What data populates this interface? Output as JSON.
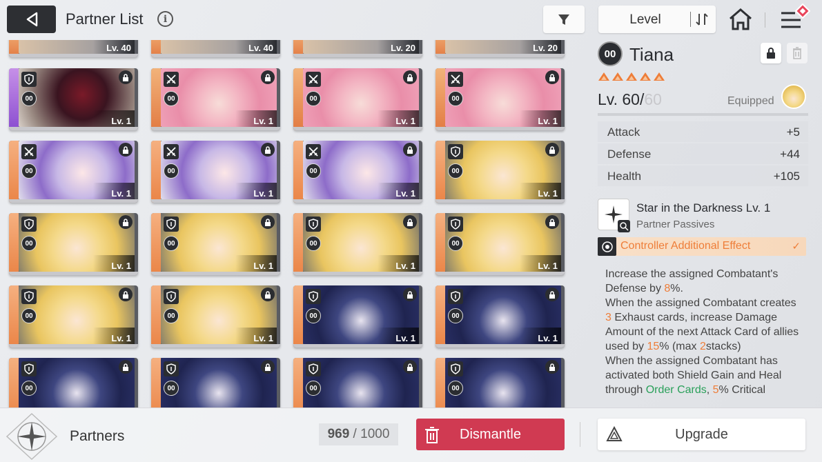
{
  "header": {
    "title": "Partner List",
    "info_glyph": "i",
    "sort_label": "Level"
  },
  "grid": {
    "top_row_levels": [
      "Lv. 40",
      "Lv. 40",
      "Lv. 20",
      "Lv. 20"
    ],
    "cards": [
      {
        "art": "dark",
        "stripe": "purple",
        "class": "shield",
        "level": "Lv. 1"
      },
      {
        "art": "pink",
        "stripe": "gold",
        "class": "swords",
        "level": "Lv. 1"
      },
      {
        "art": "pink",
        "stripe": "gold",
        "class": "swords",
        "level": "Lv. 1"
      },
      {
        "art": "pink",
        "stripe": "gold",
        "class": "swords",
        "level": "Lv. 1"
      },
      {
        "art": "purple",
        "stripe": "orange",
        "class": "swords",
        "level": "Lv. 1"
      },
      {
        "art": "purple",
        "stripe": "orange",
        "class": "swords",
        "level": "Lv. 1"
      },
      {
        "art": "purple",
        "stripe": "orange",
        "class": "swords",
        "level": "Lv. 1"
      },
      {
        "art": "blonde",
        "stripe": "orange",
        "class": "shield",
        "level": "Lv. 1"
      },
      {
        "art": "blonde",
        "stripe": "orange",
        "class": "shield",
        "level": "Lv. 1"
      },
      {
        "art": "blonde",
        "stripe": "orange",
        "class": "shield",
        "level": "Lv. 1"
      },
      {
        "art": "blonde",
        "stripe": "orange",
        "class": "shield",
        "level": "Lv. 1"
      },
      {
        "art": "blonde",
        "stripe": "orange",
        "class": "shield",
        "level": "Lv. 1"
      },
      {
        "art": "blonde",
        "stripe": "orange",
        "class": "shield",
        "level": "Lv. 1"
      },
      {
        "art": "blonde",
        "stripe": "orange",
        "class": "shield",
        "level": "Lv. 1"
      },
      {
        "art": "blue",
        "stripe": "orange",
        "class": "shield",
        "level": "Lv. 1"
      },
      {
        "art": "blue",
        "stripe": "orange",
        "class": "shield",
        "level": "Lv. 1"
      },
      {
        "art": "blue",
        "stripe": "orange",
        "class": "shield",
        "level": ""
      },
      {
        "art": "blue",
        "stripe": "orange",
        "class": "shield",
        "level": ""
      },
      {
        "art": "blue",
        "stripe": "orange",
        "class": "shield",
        "level": ""
      },
      {
        "art": "blue",
        "stripe": "orange",
        "class": "shield",
        "level": ""
      }
    ],
    "controller_glyph": "00"
  },
  "detail": {
    "controller_glyph": "00",
    "name": "Tiana",
    "stars": 5,
    "level_prefix": "Lv. 60/",
    "level_max": "60",
    "equipped_label": "Equipped",
    "stats": [
      {
        "label": "Attack",
        "value": "+5"
      },
      {
        "label": "Defense",
        "value": "+44"
      },
      {
        "label": "Health",
        "value": "+105"
      }
    ],
    "skill_name": "Star in the Darkness Lv. 1",
    "skill_type": "Partner Passives",
    "effect_label": "Controller Additional Effect",
    "desc": {
      "p1a": "Increase the assigned Combatant's Defense by ",
      "p1v": "8",
      "p1b": "%.",
      "p2a": "When the assigned Combatant creates ",
      "p2v1": "3",
      "p2b": " Exhaust cards, increase Damage Amount of the next Attack Card of allies used by ",
      "p2v2": "15",
      "p2c": "% (max ",
      "p2v3": "2",
      "p2d": "stacks)",
      "p3a": "When the assigned Combatant has activated both Shield Gain and Heal through ",
      "p3g": "Order Cards",
      "p3b": ", ",
      "p3v": "5",
      "p3c": "% Critical"
    }
  },
  "footer": {
    "partners_label": "Partners",
    "count_current": "969",
    "count_sep": " / ",
    "count_max": "1000",
    "dismantle_label": "Dismantle",
    "upgrade_label": "Upgrade"
  },
  "colors": {
    "accent_orange": "#ee7d38",
    "dismantle_red": "#d03a52",
    "dark": "#2d2f33"
  }
}
